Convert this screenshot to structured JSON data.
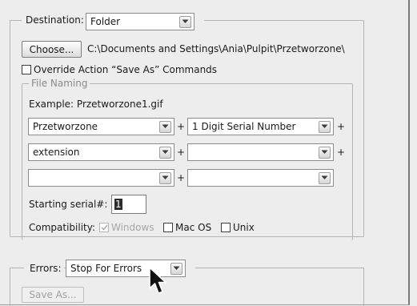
{
  "destination": {
    "label": "Destination:",
    "value": "Folder",
    "choose_label": "Choose...",
    "path": "C:\\Documents and Settings\\Ania\\Pulpit\\Przetworzone\\",
    "override_label": "Override Action “Save As” Commands",
    "override_checked": false
  },
  "file_naming": {
    "legend": "File Naming",
    "example": "Example: Przetworzone1.gif",
    "rows": [
      {
        "left": "Przetworzone",
        "right": "1 Digit Serial Number",
        "plus_mid": "+",
        "plus_end": "+"
      },
      {
        "left": "extension",
        "right": "",
        "plus_mid": "+",
        "plus_end": "+"
      },
      {
        "left": "",
        "right": "",
        "plus_mid": "+"
      }
    ],
    "serial_label": "Starting serial#:",
    "serial_value": "1",
    "compat_label": "Compatibility:",
    "compat": {
      "windows": {
        "label": "Windows",
        "checked": true,
        "disabled": true
      },
      "macos": {
        "label": "Mac OS",
        "checked": false
      },
      "unix": {
        "label": "Unix",
        "checked": false
      }
    }
  },
  "errors": {
    "label": "Errors:",
    "value": "Stop For Errors",
    "save_as_label": "Save As..."
  },
  "icons": {
    "dropdown": "chevron-down-icon",
    "cursor": "mouse-pointer-icon",
    "check": "check-icon"
  },
  "colors": {
    "panel_bg": "#ededed",
    "border": "#b4b4b4",
    "disabled": "#a6a6a6"
  }
}
